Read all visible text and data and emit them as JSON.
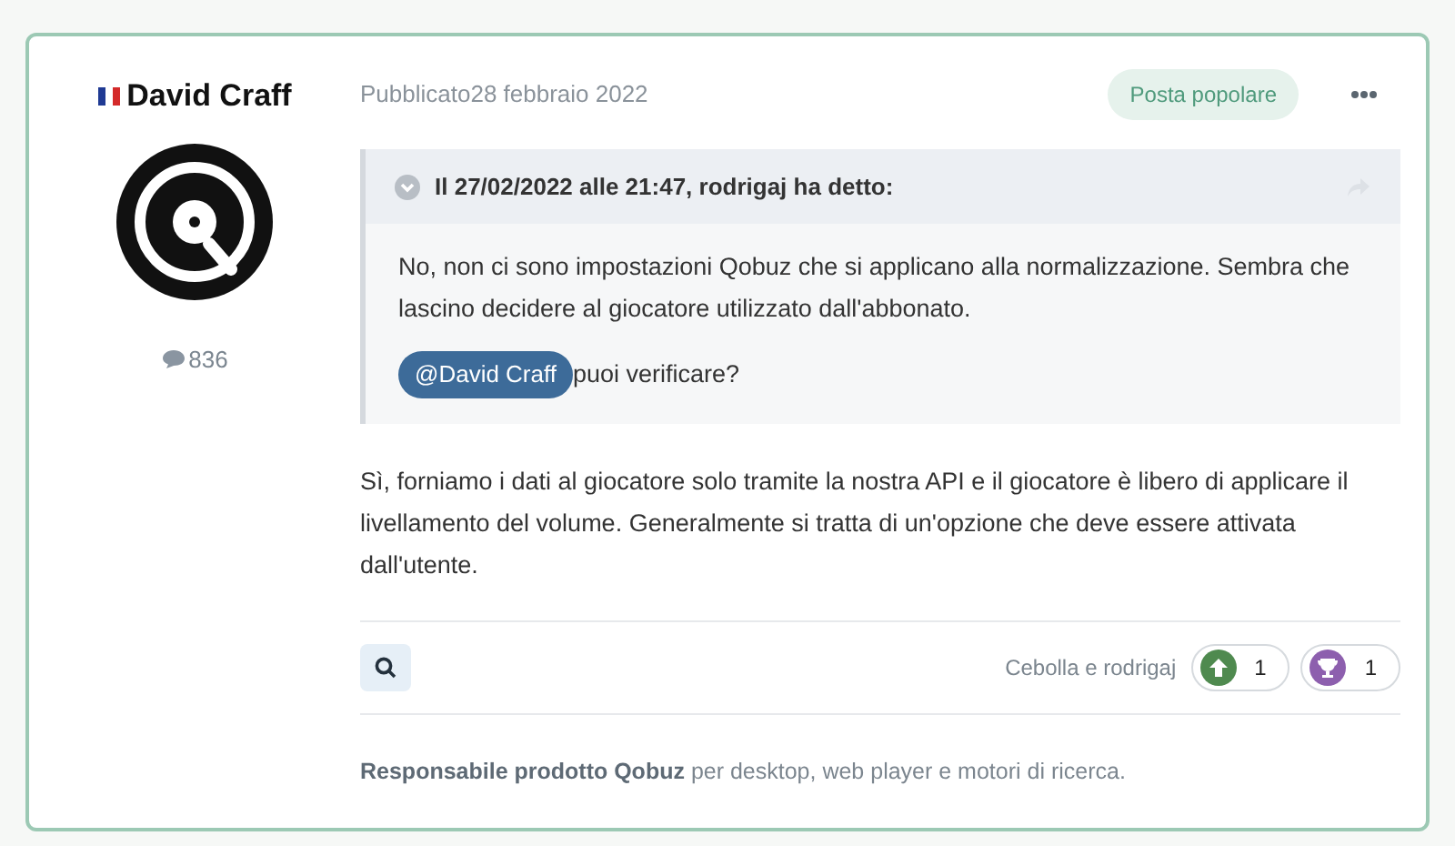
{
  "author": {
    "name": "David Craff",
    "post_count": "836"
  },
  "post": {
    "date": "Pubblicato28 febbraio 2022",
    "badge": "Posta popolare",
    "quote": {
      "header": "Il 27/02/2022 alle 21:47, rodrigaj ha detto:",
      "text": "No, non ci sono impostazioni Qobuz che si applicano alla normalizzazione. Sembra che lascino decidere al giocatore utilizzato dall'abbonato.",
      "mention": "@David Craff",
      "after_mention": "puoi verificare?"
    },
    "body": "Sì, forniamo i dati al giocatore solo tramite la nostra API e il giocatore è libero di applicare il livellamento del volume. Generalmente si tratta di un'opzione che deve essere attivata dall'utente.",
    "reacted_by": "Cebolla e rodrigaj",
    "reactions": [
      {
        "kind": "upvote",
        "color": "#4f8a4f",
        "count": "1"
      },
      {
        "kind": "trophy",
        "color": "#8d5fae",
        "count": "1"
      }
    ],
    "signature": "**Responsabile prodotto Qobuz** per desktop, web player e motori di ricerca."
  }
}
